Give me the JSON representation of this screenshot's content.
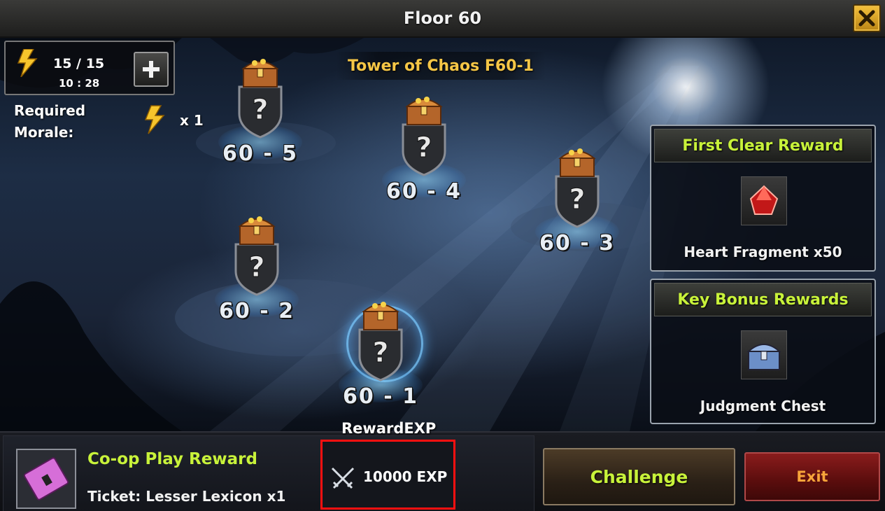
{
  "header": {
    "title": "Floor 60",
    "close_icon": "close-x-icon"
  },
  "morale": {
    "current": "15 / 15",
    "timer": "10 : 28",
    "icon": "lightning-bolt-icon",
    "add_icon": "plus-icon",
    "required_label": "Required Morale:",
    "required_multiplier": "x 1"
  },
  "tower": {
    "name": "Tower of Chaos F60-1"
  },
  "stages": [
    {
      "label": "60 - 5",
      "selected": false
    },
    {
      "label": "60 - 4",
      "selected": false
    },
    {
      "label": "60 - 3",
      "selected": false
    },
    {
      "label": "60 - 2",
      "selected": false
    },
    {
      "label": "60 - 1",
      "selected": true
    }
  ],
  "first_clear": {
    "title": "First Clear Reward",
    "item": "Heart Fragment x50",
    "icon": "red-gem-fragment-icon"
  },
  "key_bonus": {
    "title": "Key Bonus Rewards",
    "item": "Judgment Chest",
    "icon": "blue-chest-icon"
  },
  "coop": {
    "title": "Co-op Play Reward",
    "ticket": "Ticket: Lesser Lexicon x1",
    "icon": "pink-ticket-icon"
  },
  "reward_exp": {
    "label": "RewardEXP",
    "value": "10000 EXP",
    "icon": "crossed-swords-icon"
  },
  "buttons": {
    "challenge": "Challenge",
    "exit": "Exit"
  },
  "colors": {
    "accent_green": "#c8f23a",
    "title_gold": "#f5c646",
    "highlight_red": "#ff1010",
    "exit_orange": "#f7a43a"
  }
}
